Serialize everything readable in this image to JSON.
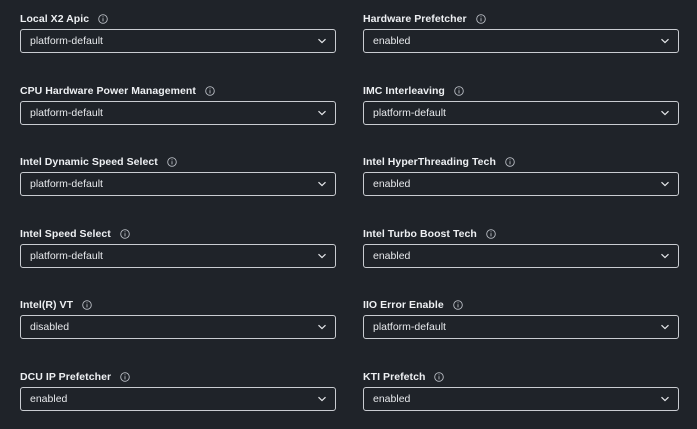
{
  "settings": [
    {
      "label": "Local X2 Apic",
      "value": "platform-default"
    },
    {
      "label": "Hardware Prefetcher",
      "value": "enabled"
    },
    {
      "label": "CPU Hardware Power Management",
      "value": "platform-default"
    },
    {
      "label": "IMC Interleaving",
      "value": "platform-default"
    },
    {
      "label": "Intel Dynamic Speed Select",
      "value": "platform-default"
    },
    {
      "label": "Intel HyperThreading Tech",
      "value": "enabled"
    },
    {
      "label": "Intel Speed Select",
      "value": "platform-default"
    },
    {
      "label": "Intel Turbo Boost Tech",
      "value": "enabled"
    },
    {
      "label": "Intel(R) VT",
      "value": "disabled"
    },
    {
      "label": "IIO Error Enable",
      "value": "platform-default"
    },
    {
      "label": "DCU IP Prefetcher",
      "value": "enabled"
    },
    {
      "label": "KTI Prefetch",
      "value": "enabled"
    }
  ],
  "icons": {
    "info": "info-icon",
    "dropdown": "chevron-down-icon"
  },
  "colors": {
    "background": "#1f2329",
    "border": "#c9ccd1",
    "text": "#eef0f3"
  }
}
